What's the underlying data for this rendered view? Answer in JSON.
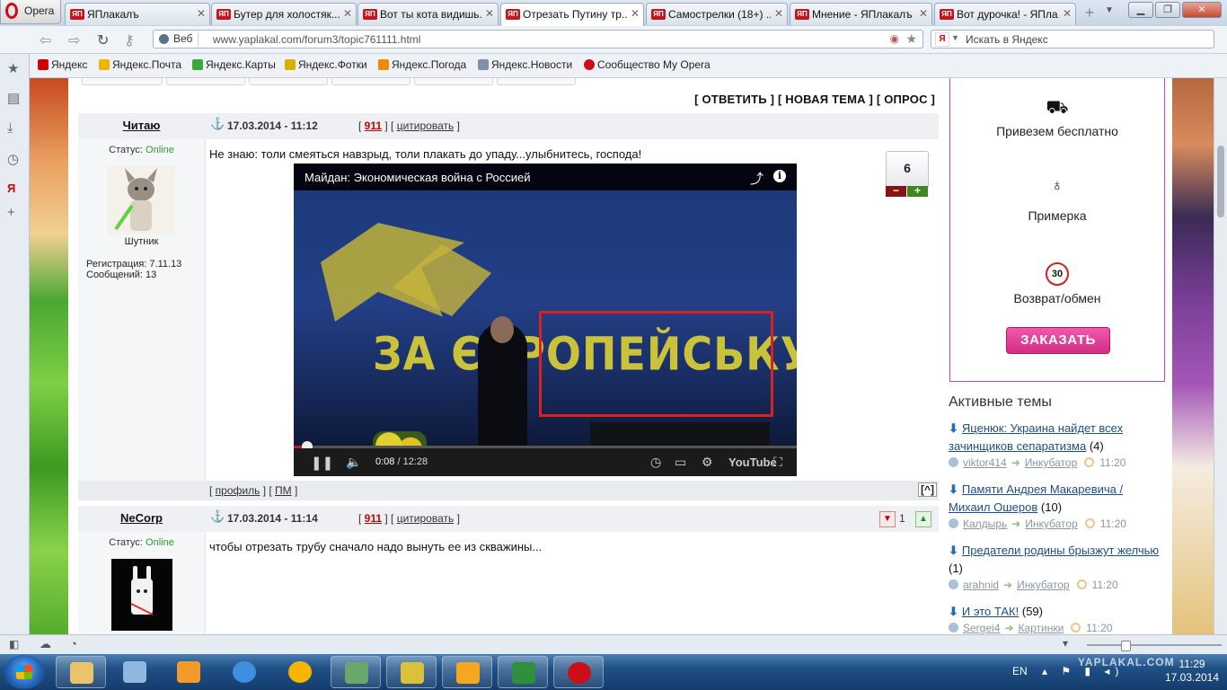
{
  "browser": {
    "menu_label": "Opera",
    "tabs": [
      {
        "label": "ЯПлакалъ",
        "active": false
      },
      {
        "label": "Бутер для холостяк...",
        "active": false
      },
      {
        "label": "Вот ты кота видишь...",
        "active": false
      },
      {
        "label": "Отрезать Путину тр...",
        "active": true
      },
      {
        "label": "Самострелки (18+) ...",
        "active": false
      },
      {
        "label": "Мнение - ЯПлакалъ",
        "active": false
      },
      {
        "label": "Вот дурочка! - ЯПла...",
        "active": false
      }
    ],
    "favicon_text": "ЯП",
    "address_mode": "Веб",
    "url": "www.yaplakal.com/forum3/topic761111.html",
    "search_placeholder": "Искать в Яндекс",
    "bookmarks": [
      {
        "label": "Яндекс",
        "color": "#d00000"
      },
      {
        "label": "Яндекс.Почта",
        "color": "#f0b400"
      },
      {
        "label": "Яндекс.Карты",
        "color": "#3aa83a"
      },
      {
        "label": "Яндекс.Фотки",
        "color": "#d8b000"
      },
      {
        "label": "Яндекс.Погода",
        "color": "#f08a00"
      },
      {
        "label": "Яндекс.Новости",
        "color": "#8090a8"
      },
      {
        "label": "Сообщество My Opera",
        "color": "#cc0f16"
      }
    ]
  },
  "forum": {
    "actions": {
      "reply": "[ ОТВЕТИТЬ ]",
      "new_topic": "[ НОВАЯ ТЕМА ]",
      "poll": "[ ОПРОС ]"
    },
    "posts": [
      {
        "author": "Читаю",
        "date": "17.03.2014 - 11:12",
        "post_number": "911",
        "quote_label": "цитировать",
        "status_label": "Статус:",
        "status_value": "Online",
        "rank": "Шутник",
        "registration": "Регистрация: 7.11.13",
        "messages": "Сообщений: 13",
        "text": "Не знаю: толи смеяться навзрыд, толи плакать до упаду...улыбнитесь, господа!",
        "rating": "6",
        "rate_minus": "−",
        "rate_plus": "+",
        "footer": {
          "profile": "профиль",
          "pm": "ПМ",
          "top": "[^]"
        },
        "video": {
          "title": "Майдан: Экономическая война с Россией",
          "banner_text": "ЗА ЄВРОПЕЙСЬКУ У",
          "current_time": "0:08",
          "total_time": "12:28",
          "progress": 0.011,
          "logo": "YouTube"
        }
      },
      {
        "author": "NeCorp",
        "date": "17.03.2014 - 11:14",
        "post_number": "911",
        "quote_label": "цитировать",
        "status_label": "Статус:",
        "status_value": "Online",
        "text": "чтобы отрезать трубу сначало надо вынуть ее из скважины...",
        "votes": "1"
      }
    ]
  },
  "sidebar": {
    "promo": [
      {
        "icon": "delivery-truck-icon",
        "label": "Привезем бесплатно"
      },
      {
        "icon": "bra-icon",
        "label": "Примерка"
      },
      {
        "icon": "return-30-icon",
        "label": "Возврат/обмен",
        "badge": "30"
      }
    ],
    "order_button": "ЗАКАЗАТЬ",
    "active_topics_title": "Активные темы",
    "topics": [
      {
        "title": "Яценюк: Украина найдет всех зачинщиков сепаратизма",
        "count": "(4)",
        "user": "viktor414",
        "section": "Инкубатор",
        "time": "11:20"
      },
      {
        "title": "Памяти Андрея Макаревича / Михаил Ошеров",
        "count": "(10)",
        "user": "Калдырь",
        "section": "Инкубатор",
        "time": "11:20"
      },
      {
        "title": "Предатели родины брызжут желчью",
        "count": "(1)",
        "user": "arahnid",
        "section": "Инкубатор",
        "time": "11:20"
      },
      {
        "title": "И это ТАК!",
        "count": "(59)",
        "user": "Sergei4",
        "section": "Картинки",
        "time": "11:20"
      }
    ]
  },
  "taskbar": {
    "language": "EN",
    "time": "11:29",
    "date": "17.03.2014",
    "watermark": "YAPLAKAL.COM",
    "apps": [
      {
        "name": "explorer",
        "color": "#e9c46a",
        "open": true
      },
      {
        "name": "paint",
        "color": "#8fb8e0",
        "open": false
      },
      {
        "name": "media-player",
        "color": "#f39a2a",
        "open": false
      },
      {
        "name": "internet-explorer",
        "color": "#3f8fe0",
        "open": false
      },
      {
        "name": "icq",
        "color": "#f7b500",
        "open": false
      },
      {
        "name": "monitor",
        "color": "#6aa86a",
        "open": true
      },
      {
        "name": "game",
        "color": "#d9c23a",
        "open": true
      },
      {
        "name": "outlook",
        "color": "#f5a623",
        "open": true
      },
      {
        "name": "excel",
        "color": "#2f8f3a",
        "open": true
      },
      {
        "name": "opera",
        "color": "#cc0f16",
        "open": true
      }
    ]
  }
}
